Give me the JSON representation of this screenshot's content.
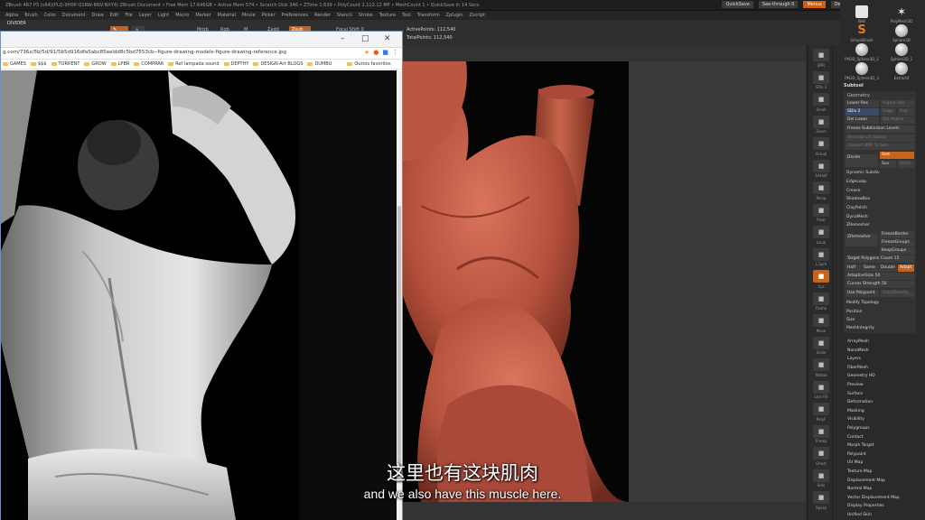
{
  "zbrush": {
    "title_text": "ZBrush 4R7 P3 (x64)(PLQ-9H0P-Q1RW-RNV-NXY4)   ZBrush Document   • Free Mem 17.646GB • Active Mem 574 • Scratch Disk 346 • ZTime 1.639 • PolyCount 2,112.12 MP • MeshCount 1 • QuickSave In 14 Secs",
    "quicksave": "QuickSave",
    "see_through": "See-through 0",
    "menus_label": "Menus",
    "default_zscript": "DefaultZScript",
    "menus": [
      "Alpha",
      "Brush",
      "Color",
      "Document",
      "Draw",
      "Edit",
      "File",
      "Layer",
      "Light",
      "Macro",
      "Marker",
      "Material",
      "Movie",
      "Picker",
      "Preferences",
      "Render",
      "Stencil",
      "Stroke",
      "Texture",
      "Tool",
      "Transform",
      "Zplugin",
      "Zscript"
    ],
    "divider_label": "DIVIDER",
    "toolbar": {
      "focal_shift": "Focal Shift 0",
      "zadd": "Zadd",
      "zsub": "Zsub",
      "rgb": "Rgb",
      "mrgb": "Mrgb",
      "m": "M"
    },
    "active_points": "ActivePoints: 112,540",
    "total_points": "TotalPoints: 112,540",
    "side_icons": [
      "BPR",
      "SPix 3",
      "Scroll",
      "Zoom",
      "Actual",
      "AAHalf",
      "Persp",
      "Floor",
      "Local",
      "L.Sym",
      "Xyz",
      "Frame",
      "Move",
      "Scale",
      "Rotate",
      "Line Fill",
      "PolyF",
      "Transp",
      "Ghost",
      "Solo",
      "Xpose"
    ],
    "brushes": [
      {
        "label": "Wall",
        "icon": "square"
      },
      {
        "label": "PolyMesh3D",
        "icon": "star"
      },
      {
        "label": "SimpleBrush",
        "icon": "s"
      },
      {
        "label": "Sphere3D",
        "icon": "sphere"
      },
      {
        "label": "PM3D_Sphere3D_1",
        "icon": "sphere"
      },
      {
        "label": "Sphere3D_1",
        "icon": "sphere"
      },
      {
        "label": "PM3D_Sphere3D_3",
        "icon": "sphere"
      },
      {
        "label": "Extract4",
        "icon": "sphere"
      }
    ],
    "subtool_label": "Subtool",
    "geometry": {
      "header": "Geometry",
      "lower_res": "Lower Res",
      "higher_res": "Higher Res",
      "sdiv": "SDiv 2",
      "cage": "Cage",
      "rstr": "Rstr",
      "del_lower": "Del Lower",
      "del_higher": "Del Higher",
      "freeze": "Freeze Subdivision Levels",
      "reconstruct": "Reconstruct Subdiv",
      "convert_bpr": "Convert BPR To Geo",
      "divide": "Divide",
      "smt": "Smt",
      "suv": "Suv",
      "reuv": "ReUV",
      "dynamic_subdiv": "Dynamic Subdiv",
      "edgeloop": "EdgeLoop",
      "crease": "Crease",
      "shadowbox": "ShadowBox",
      "claypolish": "ClayPolish",
      "dynamesh": "DynaMesh",
      "zremesher": "ZRemesher",
      "zremesher_btn": "ZRemesher",
      "freeze_border": "FreezeBorder",
      "freeze_groups": "FreezeGroups",
      "keep_groups": "KeepGroups",
      "target_polycount": "Target Polygons Count 15",
      "half": "Half",
      "same": "Same",
      "double": "Double",
      "adapt": "Adapt",
      "adaptive_size": "AdaptiveSize 50",
      "curves_strength": "Curves Strength 50",
      "use_polypaint": "Use Polypaint",
      "color_density": "ColorDensity",
      "modify_topology": "Modify Topology",
      "position": "Position",
      "size": "Size",
      "meshintegrity": "MeshIntegrity"
    },
    "tool_menu": [
      "ArrayMesh",
      "NanoMesh",
      "Layers",
      "FiberMesh",
      "Geometry HD",
      "Preview",
      "Surface",
      "Deformation",
      "Masking",
      "Visibility",
      "Polygroups",
      "Contact",
      "Morph Target",
      "Polypaint",
      "UV Map",
      "Texture Map",
      "Displacement Map",
      "Normal Map",
      "Vector Displacement Map",
      "Display Properties",
      "Unified Skin"
    ]
  },
  "browser": {
    "url": "g.com/736x/5b/5d/91/5b5d916dfa5abc85eeldd8c5bd7553cb--figure-drawing-models-figure-drawing-reference.jpg",
    "bookmarks": [
      "GAMES",
      "$$$",
      "TORRENT",
      "GROW",
      "LPBR",
      "COMPRAR",
      "Ref lampada sound",
      "DEPTHY",
      "DESIGN-Art BLOGS",
      "DUMBU"
    ],
    "other_bookmarks": "Outros favoritos",
    "window_controls": [
      "–",
      "□",
      "✕"
    ]
  },
  "subtitles": {
    "chinese": "这里也有这块肌肉",
    "english": "and we also have this muscle here."
  },
  "colors": {
    "accent": "#c8641a",
    "clay": "#b4503c",
    "subtitle": "#ffffff"
  }
}
